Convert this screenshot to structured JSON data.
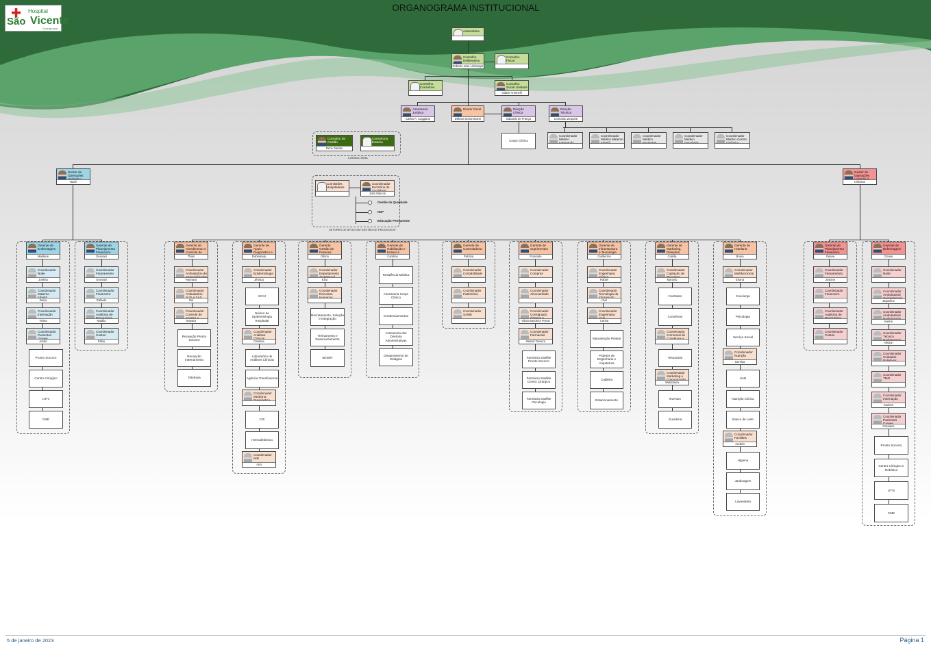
{
  "title": "ORGANOGRAMA INSTITUCIONAL",
  "logo": {
    "line1": "Hospital",
    "line2": "São",
    "line3": "Vicente",
    "line4": "Guarapuava PR"
  },
  "footer": {
    "date": "5 de janeiro de 2023",
    "page": "Página 1"
  },
  "colors": {
    "green": "#c5dd9a",
    "purple": "#d9c6e6",
    "orange": "#f6c3a4",
    "blue": "#9ed5e6",
    "red": "#f29292",
    "darkgreen": "#3d6b12",
    "lightblue": "#d6eaf1",
    "lightorange": "#f9dfce",
    "lightred": "#f6d0d0",
    "gray": "#e7e7e7"
  },
  "consultoria_label": "CONSULTORIA",
  "setores_label": "SETORES DE APOIO EM GESTÃO DE PROCESSOS",
  "nodes": [
    {
      "id": "assembleia",
      "label": "Assembleia",
      "name": "",
      "color": "green",
      "av": "icon"
    },
    {
      "id": "cons-adm",
      "label": "Conselho Deliberativo",
      "name": "Roberto José Limberger",
      "color": "green",
      "av": "photo"
    },
    {
      "id": "cons-fiscal",
      "label": "Conselho Fiscal",
      "name": "",
      "color": "green",
      "av": "icon"
    },
    {
      "id": "cons-consultivo",
      "label": "Conselho Consultivo",
      "name": "",
      "color": "green",
      "av": "icon"
    },
    {
      "id": "cons-social",
      "label": "Conselho Social Unidade II",
      "name": "Odacir Antonelli",
      "color": "green",
      "av": "photo"
    },
    {
      "id": "assessoria",
      "label": "Assessoria Jurídica",
      "name": "Carlos A. Caggiano",
      "color": "purple",
      "av": "photo"
    },
    {
      "id": "diretor-geral",
      "label": "Diretor Geral",
      "name": "Débora Schorsmann",
      "color": "orange",
      "av": "photo"
    },
    {
      "id": "direcao-clinica",
      "label": "Direção Clínica",
      "name": "Eduardo de França Borges",
      "color": "purple",
      "av": "photo"
    },
    {
      "id": "direcao-tecnica",
      "label": "Direção Técnica",
      "name": "Leonardo Zequetti Louzeiro",
      "color": "purple",
      "av": "photo"
    },
    {
      "id": "consultor",
      "label": "Consultor de Gestão",
      "name": "Rene Santos",
      "color": "darkgreen",
      "av": "photo"
    },
    {
      "id": "consultoria",
      "label": "Consultoria Externa",
      "name": "",
      "color": "darkgreen",
      "av": "icon"
    },
    {
      "id": "coord-med-int",
      "label": "Coordenador Médico Internação",
      "name": "",
      "color": "gray",
      "av": "gr"
    },
    {
      "id": "coord-med-mat",
      "label": "Coordenador Médico Materno Infantil",
      "name": "",
      "color": "gray",
      "av": "gr"
    },
    {
      "id": "coord-med-pac",
      "label": "Coordenador Médico Pacientes Graves",
      "name": "",
      "color": "gray",
      "av": "gr"
    },
    {
      "id": "coord-med-onc",
      "label": "Coordenador Médico Oncologia",
      "name": "",
      "color": "gray",
      "av": "gr"
    },
    {
      "id": "coord-med-cc",
      "label": "Coordenador Médico Centro Cirúrgico",
      "name": "",
      "color": "gray",
      "av": "gr"
    },
    {
      "id": "gestor-op1",
      "label": "Gestor de Operações Unidade I",
      "name": "Nadir",
      "color": "blue",
      "av": "photo"
    },
    {
      "id": "gestor-op2",
      "label": "Gestor de Operações Unidade II",
      "name": "Cirilzano",
      "color": "red",
      "av": "photo"
    },
    {
      "id": "comissoes",
      "label": "Comissões Hospitalares",
      "name": "",
      "color": "lightorange",
      "av": "icon"
    },
    {
      "id": "coord-qual",
      "label": "Coordenador Escritório de Qualidade",
      "name": "João Marcos",
      "color": "lightorange",
      "av": "photo"
    },
    {
      "id": "g-enf1",
      "label": "Gerente de Enfermagem",
      "name": "Marilene",
      "color": "blue",
      "av": "photo"
    },
    {
      "id": "g-plan1",
      "label": "Gerente de Planejamento Financeiro",
      "name": "Geovani",
      "color": "blue",
      "av": "photo"
    },
    {
      "id": "g-aten",
      "label": "Gerente de Atendimento e Controle de Fluxo",
      "name": "Thaís",
      "color": "orange",
      "av": "photo"
    },
    {
      "id": "g-diag",
      "label": "Gerente de Apoio Diagnóstico e Gestão de Leitos",
      "name": "Rubiamary",
      "color": "orange",
      "av": "photo"
    },
    {
      "id": "g-pess",
      "label": "Gerente Gestão de Pessoas",
      "name": "Gilson",
      "color": "orange",
      "av": "photo"
    },
    {
      "id": "g-habil",
      "label": "Gerente de Habilitação e Ensino e Pesquisa",
      "name": "Caroline",
      "color": "orange",
      "av": "photo"
    },
    {
      "id": "g-cont",
      "label": "Gerente de Controladoria",
      "name": "Patrícia",
      "color": "orange",
      "av": "photo"
    },
    {
      "id": "g-supr",
      "label": "Gerente de Suprimentos",
      "name": "Franciele",
      "color": "orange",
      "av": "photo"
    },
    {
      "id": "g-infra",
      "label": "Gerente de Infraestrutura e Tecnologia da Informação",
      "name": "Guilherme",
      "color": "orange",
      "av": "photo"
    },
    {
      "id": "g-mkt",
      "label": "Gerente de Marketing, Relações Públicas e Captação",
      "name": "Camila",
      "color": "orange",
      "av": "photo"
    },
    {
      "id": "g-hot",
      "label": "Gerente de Hotelaria",
      "name": "Bruna",
      "color": "orange",
      "av": "photo"
    },
    {
      "id": "g-plan2",
      "label": "Gerente de Planejamento Financeiro",
      "name": "Geane",
      "color": "red",
      "av": "photo"
    },
    {
      "id": "g-enf2",
      "label": "Gerente de Enfermagem",
      "name": "Cleone",
      "color": "red",
      "av": "photo"
    }
  ],
  "lists": {
    "enf1_coords": [
      {
        "label": "Coordenador Noite",
        "name": "Joelma"
      },
      {
        "label": "Coordenador Materno Infantil",
        "name": "Daiva"
      },
      {
        "label": "Coordenador Internação",
        "name": "Telma"
      },
      {
        "label": "Coordenador Pacientes Graves",
        "name": "André"
      }
    ],
    "enf1_sectors": [
      "Pronto Socorro",
      "Centro Cirúrgico",
      "UTI's",
      "CME"
    ],
    "plan1_coords": [
      {
        "label": "Coordenador Faturamento",
        "name": "Geovani"
      },
      {
        "label": "Coordenador Financeiro",
        "name": "Rafaela"
      },
      {
        "label": "Coordenador Auditoria de Prontuários",
        "name": "Natália"
      },
      {
        "label": "Coordenador Custos",
        "name": "Fábio"
      }
    ],
    "aten_coords": [
      {
        "label": "Coordenador Ambulatório de Especialidades e Plano de Saúde",
        "name": "Raynara"
      },
      {
        "label": "Coordenador Ambulatório SUS e SAS",
        "name": "Gel"
      },
      {
        "label": "Coordenador Controle de Acesso e Telefonia",
        "name": "Mayara"
      }
    ],
    "aten_sectors": [
      "Recepção Pronto Socorro",
      "Recepção Internamento",
      "Telefonia"
    ],
    "diag_items": [
      {
        "type": "c",
        "label": "Coordenador Epidemiologia",
        "name": "Jéssica"
      },
      {
        "type": "s",
        "label": "SCIH"
      },
      {
        "type": "s",
        "label": "Núcleo de Epidemiologia Hospitalar"
      },
      {
        "type": "c",
        "label": "Coordenador Análises Clínicas",
        "name": "Caroline"
      },
      {
        "type": "s",
        "label": "Laboratório de Análises Clínicas"
      },
      {
        "type": "s",
        "label": "Agência Transfusional"
      },
      {
        "type": "c",
        "label": "Coordenador Medicina Diagnóstica",
        "name": ""
      },
      {
        "type": "s",
        "label": "CDI"
      },
      {
        "type": "s",
        "label": "Hemodinâmica"
      },
      {
        "type": "c",
        "label": "Coordenador NIR",
        "name": "Ana"
      }
    ],
    "pess_coords": [
      {
        "label": "Coordenador Departamento de Pessoal",
        "name": "Elza"
      },
      {
        "label": "Coordenador Recursos Humanos",
        "name": ""
      }
    ],
    "pess_sectors": [
      "Recrutamento, Seleção e Integração",
      "Treinamento e Desenvolvimento",
      "SESMT"
    ],
    "habil_sectors": [
      "Residência Médica",
      "Assessoria Corpo Clínico",
      "Credenciamentos",
      "Assessoria dos Diretoria Administrativas",
      "Departamento de Estágios"
    ],
    "cont_coords": [
      {
        "label": "Coordenador Contabilidade",
        "name": ""
      },
      {
        "label": "Coordenador Patrimônio",
        "name": ""
      },
      {
        "label": "Coordenador SAME",
        "name": ""
      }
    ],
    "supr_coords": [
      {
        "label": "Coordenador Compras",
        "name": ""
      },
      {
        "label": "Coordenador Almoxarifado",
        "name": ""
      },
      {
        "label": "Coordenador Consignado Órteses e Próteses",
        "name": "Vânia Bandeira Ferraz"
      },
      {
        "label": "Coordenador Farmácias",
        "name": "Maneli Teixeira"
      }
    ],
    "supr_sectors": [
      "Farmácia Satélite Pronto Socorro",
      "Farmácia Satélite Centro Cirúrgico",
      "Farmácia Satélite Oncologia"
    ],
    "infra_coords": [
      {
        "label": "Coordenador Engenharia Clínica",
        "name": "Rafael"
      },
      {
        "label": "Coordenador Tecnologia da Informação",
        "name": "Iziel"
      },
      {
        "label": "Coordenador Engenharia Civil",
        "name": "Carina"
      }
    ],
    "infra_sectors": [
      "Manutenção Predial",
      "Projetos de Engenharia e Arquitetura",
      "Caldeira",
      "Estacionamento"
    ],
    "mkt_items": [
      {
        "type": "c",
        "label": "Coordenador Captação de Recursos",
        "name": "Marcelo"
      },
      {
        "type": "s",
        "label": "Contratos"
      },
      {
        "type": "s",
        "label": "Convênios"
      },
      {
        "type": "c",
        "label": "Coordenador Comercial de Convênios e Negócios",
        "name": ""
      },
      {
        "type": "s",
        "label": "Tesouraria"
      },
      {
        "type": "c",
        "label": "Coordenador Marketing e Comunicação",
        "name": "Waldomira"
      },
      {
        "type": "s",
        "label": "Eventos"
      },
      {
        "type": "s",
        "label": "Ouvidoria"
      }
    ],
    "hot_items": [
      {
        "type": "c",
        "label": "Coordenador Multifuncional",
        "name": "Eriana"
      },
      {
        "type": "s",
        "label": "Concierge"
      },
      {
        "type": "s",
        "label": "Psicologia"
      },
      {
        "type": "s",
        "label": "Serviço Social"
      },
      {
        "type": "c",
        "label": "Coordenador Nutrição",
        "name": "Gerelza"
      },
      {
        "type": "s",
        "label": "UAN"
      },
      {
        "type": "s",
        "label": "Nutrição Clínica"
      },
      {
        "type": "s",
        "label": "Banco de Leite"
      },
      {
        "type": "c",
        "label": "Coordenador Facilities",
        "name": "Andréa"
      },
      {
        "type": "s",
        "label": "Higiene"
      },
      {
        "type": "s",
        "label": "Jardinagem"
      },
      {
        "type": "s",
        "label": "Lavanderia"
      }
    ],
    "plan2_coords": [
      {
        "label": "Coordenador Faturamento",
        "name": "Josiane"
      },
      {
        "label": "Coordenador Financeiro",
        "name": ""
      },
      {
        "label": "Coordenador Auditoria de Prontuários",
        "name": ""
      },
      {
        "label": "Coordenador Custos",
        "name": ""
      }
    ],
    "enf2_coords": [
      {
        "label": "Coordenador Noite",
        "name": ""
      },
      {
        "label": "Coordenador Ambulatorial Quimioterapia",
        "name": "Jaqueline"
      },
      {
        "label": "Coordenador Ambulatorial Radioterapia",
        "name": "Karine"
      },
      {
        "label": "Coordenador Técnico Radioterapia",
        "name": "Alisson"
      },
      {
        "label": "Coordenador Cuidados Paliativos",
        "name": ""
      },
      {
        "label": "Coordenador TMO",
        "name": ""
      },
      {
        "label": "Coordenador Internação",
        "name": "Suelem"
      },
      {
        "label": "Coordenador Pacientes Graves",
        "name": "Cassiane"
      }
    ],
    "enf2_sectors": [
      "Pronto Socorro",
      "Centro Cirúrgico e Robótica",
      "UTI's",
      "CME"
    ],
    "corpo_clinico": "Corpo Clínico",
    "qual_items": [
      "Gestão da Qualidade",
      "NSP",
      "Educação Permanente"
    ]
  }
}
